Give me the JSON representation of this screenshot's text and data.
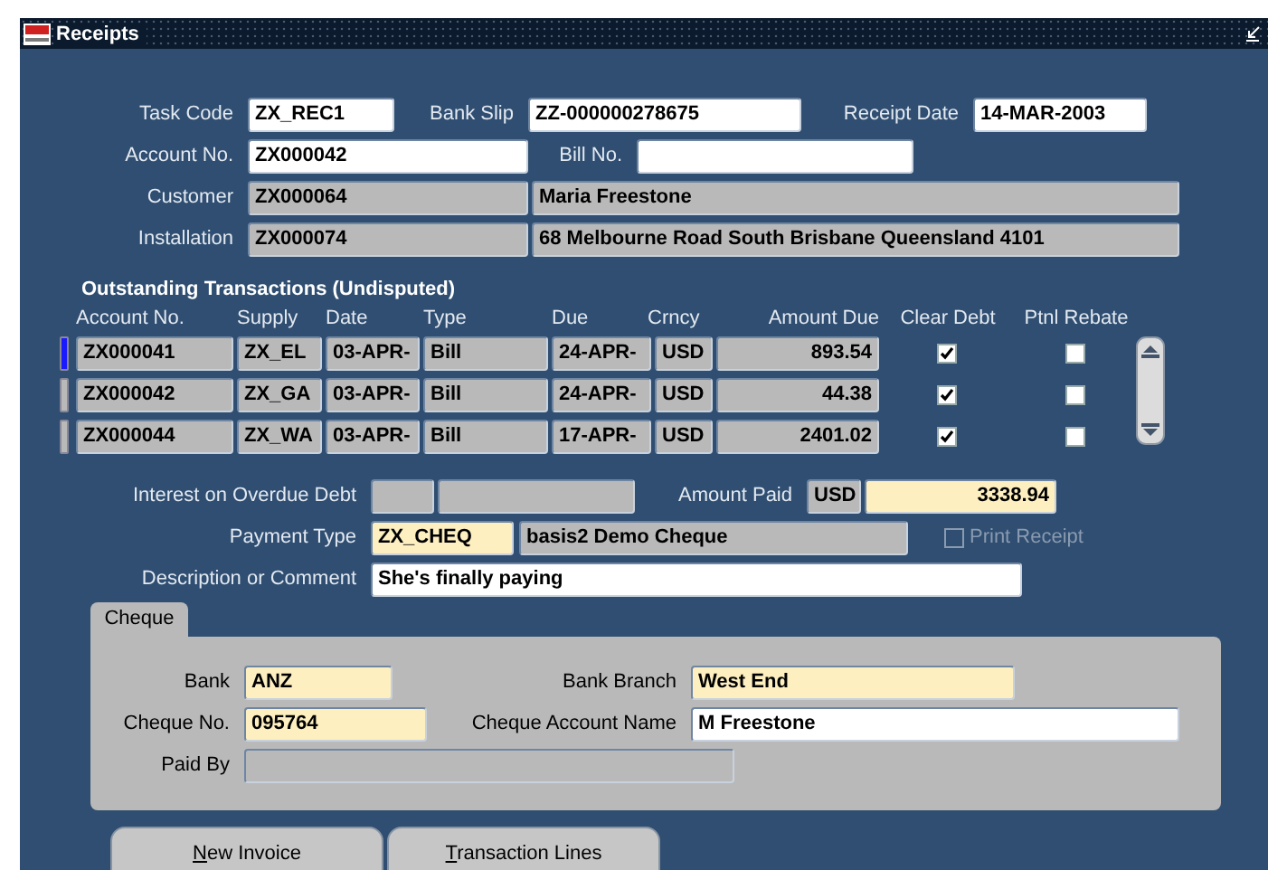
{
  "window": {
    "title": "Receipts"
  },
  "header": {
    "task_code": {
      "label": "Task Code",
      "value": "ZX_REC1",
      "kind": "editable"
    },
    "bank_slip": {
      "label": "Bank Slip",
      "value": "ZZ-000000278675",
      "kind": "editable"
    },
    "receipt_date": {
      "label": "Receipt Date",
      "value": "14-MAR-2003",
      "kind": "editable"
    },
    "account_no": {
      "label": "Account No.",
      "value": "ZX000042",
      "kind": "editable"
    },
    "bill_no": {
      "label": "Bill No.",
      "kind": "editable"
    },
    "customer": {
      "label": "Customer",
      "code": {
        "value": "ZX000064",
        "kind": "readonly"
      },
      "name": {
        "value": "Maria Freestone",
        "kind": "readonly"
      }
    },
    "installation": {
      "label": "Installation",
      "code": {
        "value": "ZX000074",
        "kind": "readonly"
      },
      "name": {
        "value": "68 Melbourne Road South Brisbane Queensland 4101",
        "kind": "readonly"
      }
    }
  },
  "transactions": {
    "title": "Outstanding Transactions (Undisputed)",
    "columns": [
      "Account No.",
      "Supply",
      "Date",
      "Type",
      "Due",
      "Crncy",
      "Amount Due",
      "Clear Debt",
      "Ptnl Rebate"
    ],
    "rows": [
      {
        "selected": true,
        "account_no": "ZX000041",
        "supply": "ZX_EL",
        "date": "03-APR-",
        "type": "Bill",
        "due": "24-APR-",
        "currency": "USD",
        "amount_due": "893.54",
        "clear_debt": true,
        "partial_rebate": false
      },
      {
        "selected": false,
        "account_no": "ZX000042",
        "supply": "ZX_GA",
        "date": "03-APR-",
        "type": "Bill",
        "due": "24-APR-",
        "currency": "USD",
        "amount_due": "44.38",
        "clear_debt": true,
        "partial_rebate": false
      },
      {
        "selected": false,
        "account_no": "ZX000044",
        "supply": "ZX_WA",
        "date": "03-APR-",
        "type": "Bill",
        "due": "17-APR-",
        "currency": "USD",
        "amount_due": "2401.02",
        "clear_debt": true,
        "partial_rebate": false
      }
    ]
  },
  "payment": {
    "interest": {
      "label": "Interest on Overdue Debt",
      "fields": [
        {
          "kind": "readonly"
        },
        {
          "kind": "readonly"
        }
      ]
    },
    "amount_paid": {
      "label": "Amount Paid",
      "currency": {
        "value": "USD",
        "kind": "readonly"
      },
      "amount": {
        "value": "3338.94",
        "kind": "required"
      }
    },
    "payment_type": {
      "label": "Payment Type",
      "code": {
        "value": "ZX_CHEQ",
        "kind": "required"
      },
      "name": {
        "value": "basis2 Demo Cheque",
        "kind": "readonly"
      }
    },
    "print_receipt": {
      "label": "Print Receipt",
      "checked": false,
      "disabled": true
    },
    "description": {
      "label": "Description or Comment",
      "value": "She's finally paying",
      "kind": "editable"
    }
  },
  "tabs": [
    {
      "label": "Cheque",
      "selected": true
    }
  ],
  "cheque": {
    "bank": {
      "label": "Bank",
      "value": "ANZ",
      "kind": "required"
    },
    "bank_branch": {
      "label": "Bank Branch",
      "value": "West End",
      "kind": "required"
    },
    "cheque_no": {
      "label": "Cheque No.",
      "value": "095764",
      "kind": "required"
    },
    "cheque_account_name": {
      "label": "Cheque Account Name",
      "value": "M Freestone",
      "kind": "editable"
    },
    "paid_by": {
      "label": "Paid By",
      "kind": "readonly"
    }
  },
  "buttons": [
    {
      "label": "New Invoice"
    },
    {
      "label": "Transaction Lines"
    }
  ]
}
